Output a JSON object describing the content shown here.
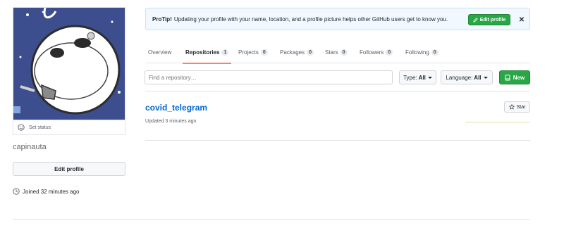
{
  "profile": {
    "username": "capinauta",
    "set_status": "Set status",
    "edit_profile": "Edit profile",
    "joined": "Joined 32 minutes ago"
  },
  "protip": {
    "label": "ProTip!",
    "text": "Updating your profile with your name, location, and a profile picture helps other GitHub users get to know you.",
    "edit_button": "Edit profile",
    "close": "✕"
  },
  "tabs": [
    {
      "label": "Overview",
      "count": null
    },
    {
      "label": "Repositories",
      "count": "1"
    },
    {
      "label": "Projects",
      "count": "0"
    },
    {
      "label": "Packages",
      "count": "0"
    },
    {
      "label": "Stars",
      "count": "0"
    },
    {
      "label": "Followers",
      "count": "0"
    },
    {
      "label": "Following",
      "count": "0"
    }
  ],
  "filters": {
    "search_placeholder": "Find a repository…",
    "type_label": "Type:",
    "type_value": "All",
    "language_label": "Language:",
    "language_value": "All",
    "new_button": "New"
  },
  "repos": [
    {
      "name": "covid_telegram",
      "updated": "Updated 3 minutes ago",
      "star_label": "Star"
    }
  ],
  "colors": {
    "accent_green": "#28a745",
    "link_blue": "#0366d6",
    "tab_underline": "#f9826c"
  }
}
